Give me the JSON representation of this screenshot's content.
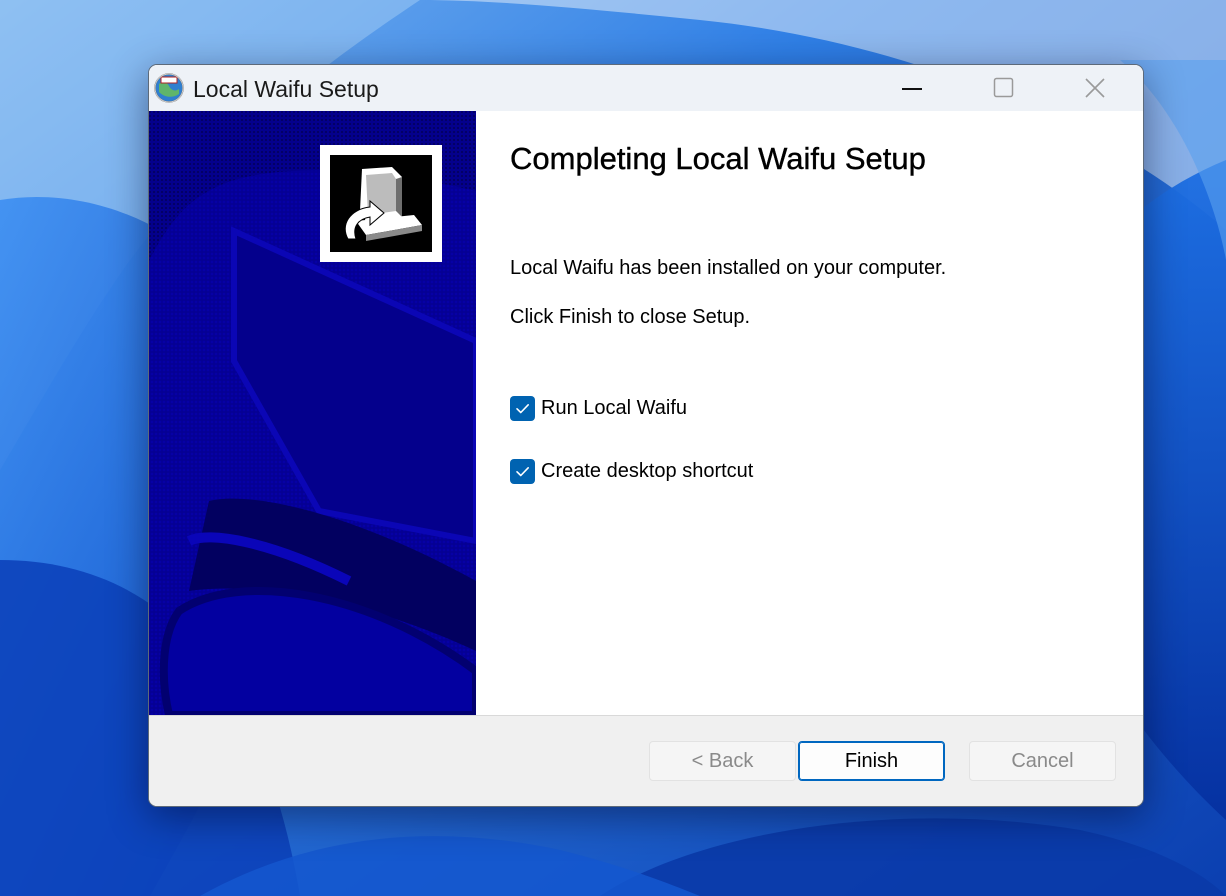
{
  "window": {
    "title": "Local Waifu Setup",
    "controls": {
      "minimize": "minimize-icon",
      "maximize": "maximize-icon",
      "close": "close-icon"
    }
  },
  "content": {
    "heading": "Completing Local Waifu Setup",
    "installed_text": "Local Waifu has been installed on your computer.",
    "finish_hint": "Click Finish to close Setup.",
    "options": [
      {
        "label": "Run Local Waifu",
        "checked": true
      },
      {
        "label": "Create desktop shortcut",
        "checked": true
      }
    ]
  },
  "buttons": {
    "back": "< Back",
    "finish": "Finish",
    "cancel": "Cancel"
  },
  "colors": {
    "banner": "#04008c",
    "accent": "#0063b1",
    "desktop": "#1f6fd6"
  }
}
